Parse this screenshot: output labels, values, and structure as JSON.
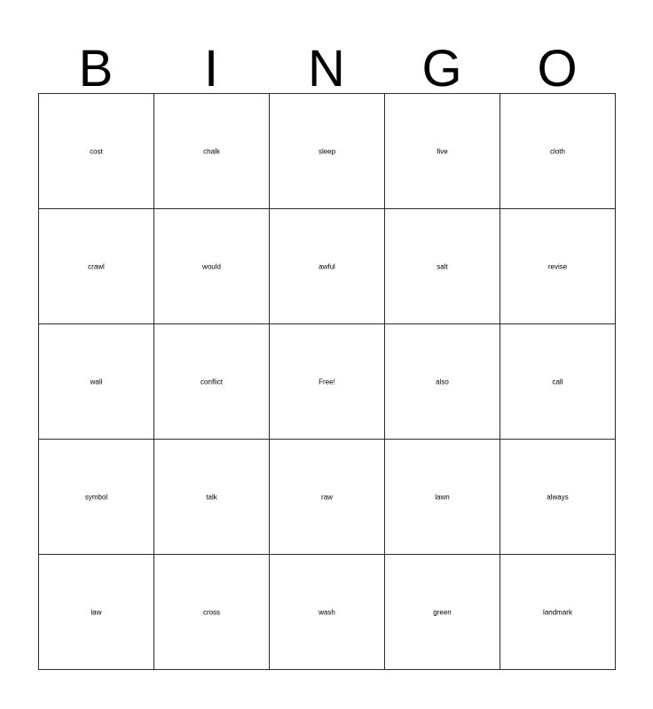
{
  "card": {
    "title": "BINGO",
    "free_space_label": "Free!",
    "columns": [
      {
        "letter": "B"
      },
      {
        "letter": "I"
      },
      {
        "letter": "N"
      },
      {
        "letter": "G"
      },
      {
        "letter": "O"
      }
    ],
    "rows": [
      {
        "cells": [
          {
            "text": "cost",
            "size": "lg"
          },
          {
            "text": "chalk",
            "size": "md"
          },
          {
            "text": "sleep",
            "size": "md"
          },
          {
            "text": "five",
            "size": "lg"
          },
          {
            "text": "cloth",
            "size": "md"
          }
        ]
      },
      {
        "cells": [
          {
            "text": "crawl",
            "size": "md"
          },
          {
            "text": "would",
            "size": "md"
          },
          {
            "text": "awful",
            "size": "md"
          },
          {
            "text": "salt",
            "size": "lg"
          },
          {
            "text": "revise",
            "size": "sm"
          }
        ]
      },
      {
        "cells": [
          {
            "text": "wall",
            "size": "xl"
          },
          {
            "text": "conflict",
            "size": "sm"
          },
          {
            "text": "Free!",
            "size": "lg"
          },
          {
            "text": "also",
            "size": "lg"
          },
          {
            "text": "call",
            "size": "lg"
          }
        ]
      },
      {
        "cells": [
          {
            "text": "symbol",
            "size": "sm"
          },
          {
            "text": "talk",
            "size": "xl"
          },
          {
            "text": "raw",
            "size": "xl"
          },
          {
            "text": "lawn",
            "size": "lg"
          },
          {
            "text": "always",
            "size": "sm"
          }
        ]
      },
      {
        "cells": [
          {
            "text": "law",
            "size": "xl"
          },
          {
            "text": "cross",
            "size": "md"
          },
          {
            "text": "wash",
            "size": "md"
          },
          {
            "text": "green",
            "size": "md"
          },
          {
            "text": "landmark",
            "size": "xs"
          }
        ]
      }
    ],
    "colors": {
      "background": "#ffffff",
      "text": "#000000",
      "border": "#2b2b2b"
    }
  }
}
